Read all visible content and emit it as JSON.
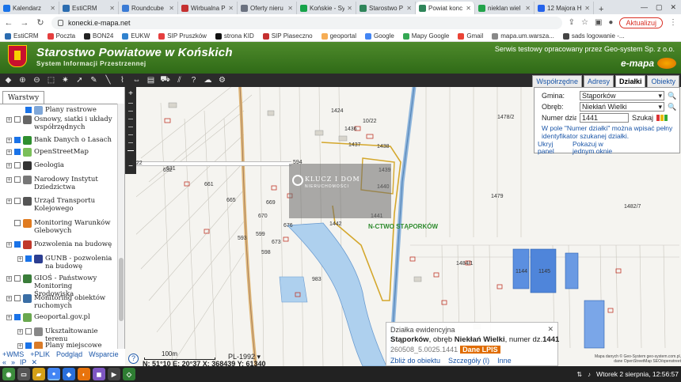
{
  "browser": {
    "tabs": [
      {
        "title": "Kalendarz",
        "color": "#1a73e8"
      },
      {
        "title": "EstiCRM",
        "color": "#2b6cb0"
      },
      {
        "title": "Roundcube",
        "color": "#3a7bd5"
      },
      {
        "title": "Wirbualna P",
        "color": "#c53030"
      },
      {
        "title": "Oferty nieru",
        "color": "#6b7280"
      },
      {
        "title": "Końskie - Sy",
        "color": "#16a34a"
      },
      {
        "title": "Starostwo P",
        "color": "#2f855a"
      },
      {
        "title": "Powiat konc",
        "color": "#2f855a",
        "active": true
      },
      {
        "title": "nieklan wiel",
        "color": "#22a34a"
      },
      {
        "title": "12 Majora H",
        "color": "#2563eb"
      }
    ],
    "url": "konecki.e-mapa.net",
    "update_label": "Aktualizuj",
    "bookmarks": [
      {
        "label": "EstiCRM",
        "color": "#2b6cb0"
      },
      {
        "label": "Poczta",
        "color": "#e53e3e"
      },
      {
        "label": "BON24",
        "color": "#222"
      },
      {
        "label": "EUKW",
        "color": "#3182ce"
      },
      {
        "label": "SIP Pruszków",
        "color": "#e53e3e"
      },
      {
        "label": "strona KID",
        "color": "#111"
      },
      {
        "label": "SIP Piaseczno",
        "color": "#c53030"
      },
      {
        "label": "geoportal",
        "color": "#f6ad55"
      },
      {
        "label": "Google",
        "color": "#4285f4"
      },
      {
        "label": "Mapy Google",
        "color": "#34a853"
      },
      {
        "label": "Gmail",
        "color": "#ea4335"
      },
      {
        "label": "mapa.um.warsza...",
        "color": "#888"
      },
      {
        "label": "sads logowanie -...",
        "color": "#444"
      }
    ]
  },
  "site": {
    "title": "Starostwo Powiatowe w Końskich",
    "subtitle": "System Informacji Przestrzennej",
    "note": "Serwis testowy opracowany przez Geo-system Sp. z o.o.",
    "brand": "e-mapa"
  },
  "right_tabs": [
    "Współrzędne",
    "Adresy",
    "Działki",
    "Obiekty"
  ],
  "left_panel": {
    "tab": "Warstwy",
    "layers": [
      {
        "label": "Plany rastrowe",
        "checked": true,
        "expandable": false,
        "indent": 1,
        "color": "#7fa7d8"
      },
      {
        "label": "Osnowy, siatki i układy współrzędnych",
        "checked": false,
        "expandable": true,
        "indent": 0,
        "color": "#666"
      },
      {
        "label": "Bank Danych o Lasach",
        "checked": true,
        "expandable": true,
        "indent": 0,
        "color": "#2f8f2f"
      },
      {
        "label": "OpenStreetMap",
        "checked": true,
        "expandable": true,
        "indent": 0,
        "color": "#7bbf5a"
      },
      {
        "label": "Geologia",
        "checked": false,
        "expandable": true,
        "indent": 0,
        "color": "#333"
      },
      {
        "label": "Narodowy Instytut Dziedzictwa",
        "checked": false,
        "expandable": true,
        "indent": 0,
        "color": "#777"
      },
      {
        "label": "Urząd Transportu Kolejowego",
        "checked": false,
        "expandable": true,
        "indent": 0,
        "color": "#555"
      },
      {
        "label": "Monitoring Warunków Glebowych",
        "checked": false,
        "expandable": false,
        "indent": 0,
        "color": "#e07b20"
      },
      {
        "label": "Pozwolenia na budowę",
        "checked": true,
        "expandable": true,
        "indent": 0,
        "color": "#c0392b"
      },
      {
        "label": "GUNB - pozwolenia na budowę",
        "checked": true,
        "expandable": true,
        "indent": 1,
        "color": "#2c3e91"
      },
      {
        "label": "GIOŚ - Państwowy Monitoring Środowiska",
        "checked": false,
        "expandable": true,
        "indent": 0,
        "color": "#3a7d3a"
      },
      {
        "label": "Monitoring obiektów ruchomych",
        "checked": false,
        "expandable": true,
        "indent": 0,
        "color": "#3a6ea5"
      },
      {
        "label": "Geoportal.gov.pl",
        "checked": true,
        "expandable": true,
        "indent": 0,
        "color": "#6aa84f"
      },
      {
        "label": "Ukształtowanie terenu",
        "checked": false,
        "expandable": true,
        "indent": 1,
        "color": "#888"
      },
      {
        "label": "Plany miejscowe",
        "checked": true,
        "expandable": true,
        "indent": 1,
        "color": "#d97b29"
      }
    ],
    "footer_links": [
      "+WMS",
      "+PLIK",
      "Podgląd",
      "Wsparcie"
    ],
    "footer_links2": [
      "«",
      "»",
      "IP",
      "✕"
    ]
  },
  "search": {
    "gmina_label": "Gmina:",
    "gmina_value": "Stąporków",
    "obreb_label": "Obręb:",
    "obreb_value": "Niekłań Wielki",
    "numer_label": "Numer dział",
    "numer_value": "1441",
    "search_btn": "Szukaj",
    "info": "W pole \"Numer działki\" można wpisać pełny identyfikator szukanej działki.",
    "hide_panel": "Ukryj panel",
    "show_one": "Pokazuj w jednym oknie"
  },
  "map": {
    "parcels": [
      "1478/2",
      "1436",
      "1424",
      "1437",
      "1438",
      "1439",
      "1440",
      "1441",
      "1442",
      "1479",
      "1482/7",
      "1484/1",
      "1144",
      "1145",
      "1/22",
      "632",
      "631",
      "661",
      "665",
      "669",
      "670",
      "676",
      "673",
      "599",
      "593",
      "598",
      "594",
      "983",
      "10/22"
    ],
    "gmina_label": "N-CTWO STĄPORKÓW",
    "watermark": "KLUCZ I DOM",
    "watermark_sub": "NIERUCHOMOŚCI",
    "scale": "100m",
    "projection": "PL-1992",
    "coords": "N: 51°10  E: 20°37  X: 368439  Y: 61340",
    "attribution": "Mapa danych © Geo-System geo-system.com.pl, dane OpenStreetMap SEO/openstreet"
  },
  "popup": {
    "title": "Działka ewidencyjna",
    "location_gmina": "Stąporków",
    "location_mid": ", obręb ",
    "location_obreb": "Niekłań Wielki",
    "location_num_label": ", numer dz.",
    "location_num": "1441",
    "id": "260508_5.0025.1441",
    "lpis": "Dane LPIS",
    "links": [
      "Zbliż do obiektu",
      "Szczegóły (I)",
      "Inne"
    ]
  },
  "taskbar": {
    "clock": "Wtorek  2 sierpnia, 12:56:57"
  }
}
